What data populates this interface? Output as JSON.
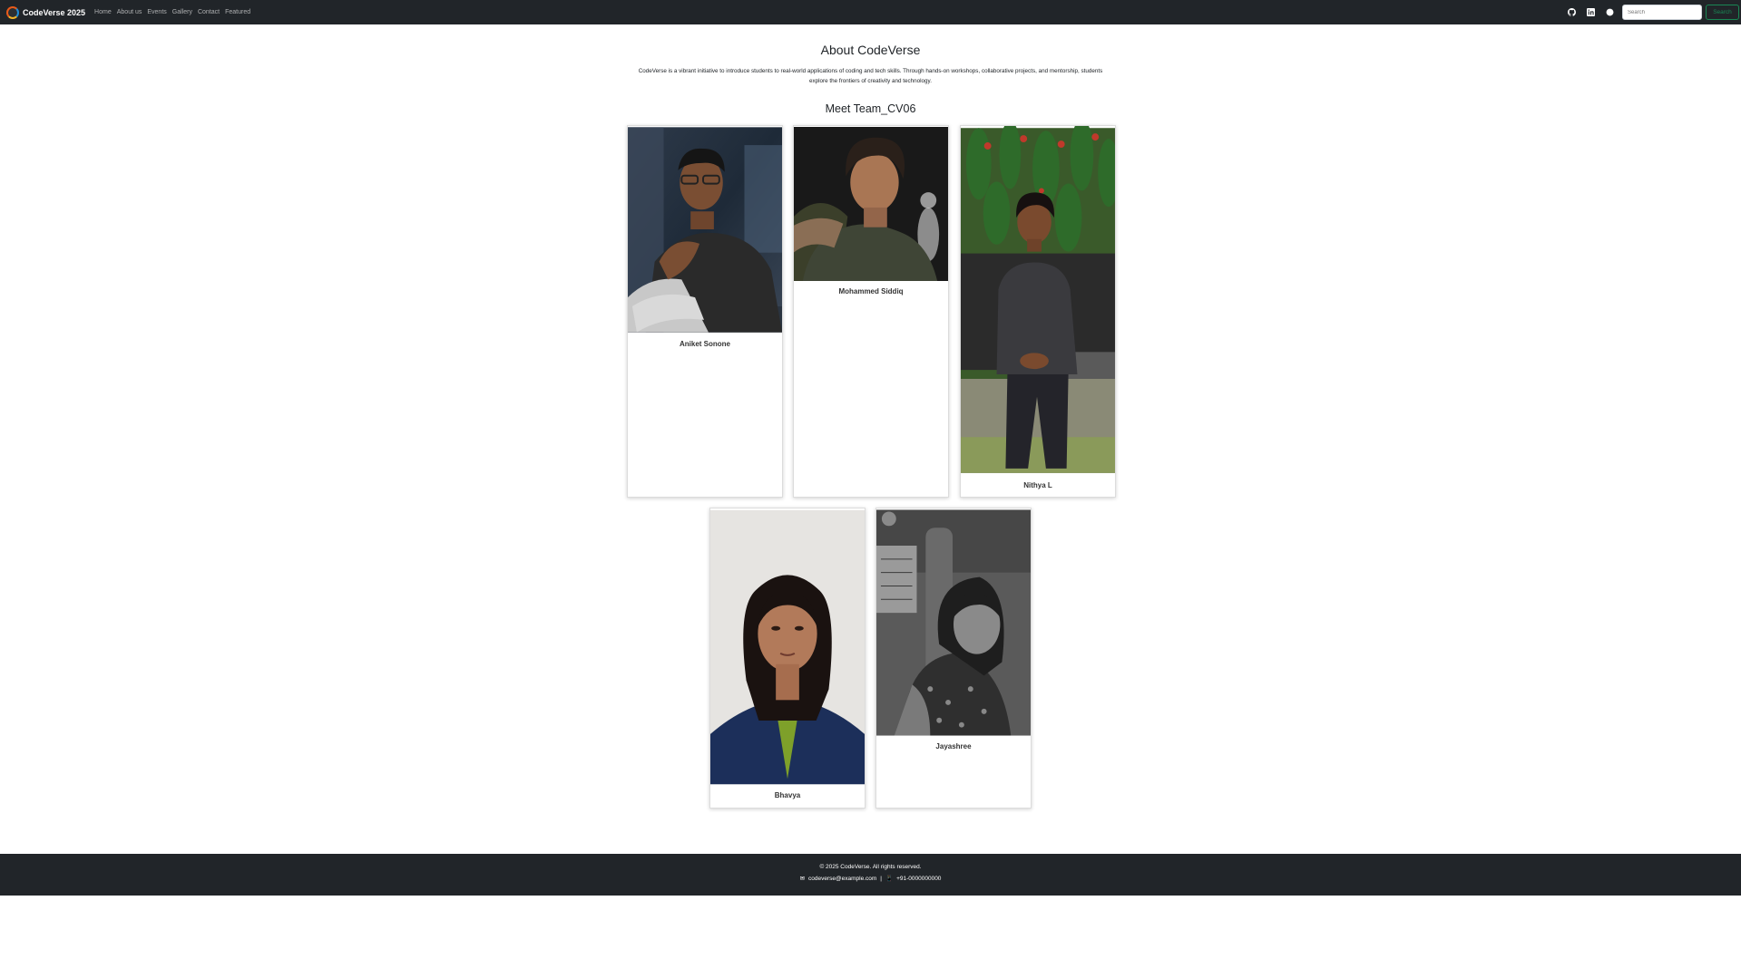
{
  "navbar": {
    "brand": "CodeVerse 2025",
    "links": [
      "Home",
      "About us",
      "Events",
      "Gallery",
      "Contact",
      "Featured"
    ],
    "search_placeholder": "Search",
    "search_button": "Search",
    "icons": [
      "github-icon",
      "linkedin-icon",
      "theme-toggle-icon"
    ]
  },
  "about": {
    "title": "About CodeVerse",
    "description": "CodeVerse is a vibrant initiative to introduce students to real-world applications of coding and tech skills. Through hands-on workshops, collaborative projects, and mentorship, students explore the frontiers of creativity and technology."
  },
  "team": {
    "title": "Meet Team_CV06",
    "members": [
      {
        "name": "Aniket Sonone"
      },
      {
        "name": "Mohammed Siddiq"
      },
      {
        "name": "Nithya L"
      },
      {
        "name": "Bhavya"
      },
      {
        "name": "Jayashree"
      }
    ]
  },
  "footer": {
    "copyright": "© 2025 CodeVerse. All rights reserved.",
    "email_icon": "✉",
    "email": "codeverse@example.com",
    "separator": "|",
    "phone_icon": "📱",
    "phone": "+91-0000000000"
  },
  "colors": {
    "navbar_bg": "#212529",
    "footer_bg": "#212529",
    "search_accent": "#198754"
  }
}
